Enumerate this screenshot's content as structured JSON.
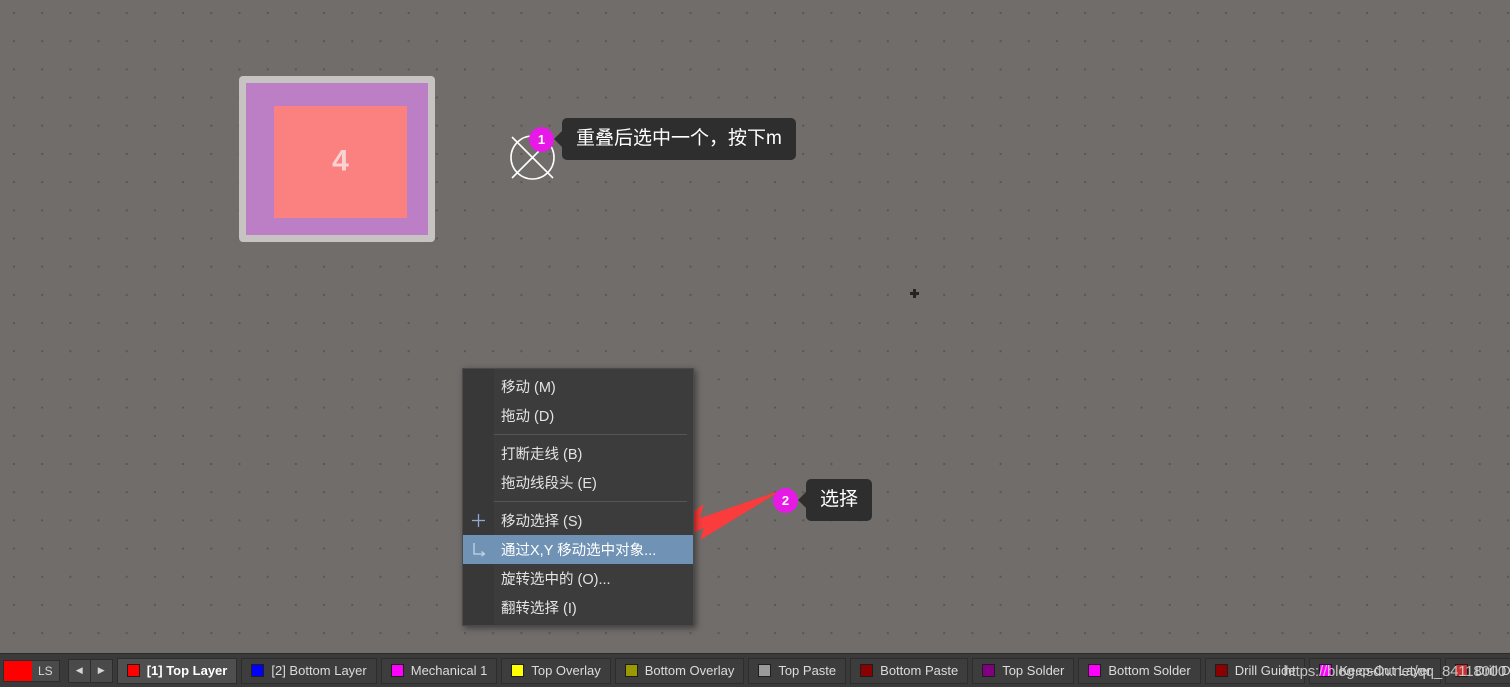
{
  "canvas": {
    "pad": {
      "label": "4",
      "outer_color": "#c6c3c2",
      "mid_color": "#bc7fc5",
      "inner_color": "#fb8080"
    },
    "cursor_icon": "circle-x-cursor-icon"
  },
  "callouts": [
    {
      "number": "1",
      "text": "重叠后选中一个，按下m"
    },
    {
      "number": "2",
      "text": "选择"
    }
  ],
  "context_menu": {
    "items": [
      {
        "label": "移动 (M)",
        "icon": "",
        "selected": false
      },
      {
        "label": "拖动 (D)",
        "icon": "",
        "selected": false
      },
      {
        "label": "打断走线 (B)",
        "icon": "",
        "selected": false
      },
      {
        "label": "拖动线段头 (E)",
        "icon": "",
        "selected": false
      },
      {
        "label": "移动选择 (S)",
        "icon": "crosshair-icon",
        "selected": false
      },
      {
        "label": "通过X,Y 移动选中对象...",
        "icon": "move-xy-icon",
        "selected": true
      },
      {
        "label": "旋转选中的 (O)...",
        "icon": "",
        "selected": false
      },
      {
        "label": "翻转选择 (I)",
        "icon": "",
        "selected": false
      }
    ],
    "separator_after": [
      1,
      3
    ],
    "highlight_color": "#7093b5"
  },
  "layer_bar": {
    "ls_chip": {
      "label": "LS",
      "color": "#ff0000"
    },
    "nav_prev": "◀",
    "nav_next": "▶",
    "tabs": [
      {
        "label": "[1] Top Layer",
        "color": "#ff0000",
        "active": true
      },
      {
        "label": "[2] Bottom Layer",
        "color": "#0000ff",
        "active": false
      },
      {
        "label": "Mechanical 1",
        "color": "#ff00ff",
        "active": false
      },
      {
        "label": "Top Overlay",
        "color": "#ffff00",
        "active": false
      },
      {
        "label": "Bottom Overlay",
        "color": "#9a9a00",
        "active": false
      },
      {
        "label": "Top Paste",
        "color": "#9a9a9a",
        "active": false
      },
      {
        "label": "Bottom Paste",
        "color": "#8b0000",
        "active": false
      },
      {
        "label": "Top Solder",
        "color": "#800080",
        "active": false
      },
      {
        "label": "Bottom Solder",
        "color": "#ff00ff",
        "active": false
      },
      {
        "label": "Drill Guide",
        "color": "#8b0000",
        "active": false
      },
      {
        "label": "Keep-Out Layer",
        "color": "#ff00ff",
        "active": false
      },
      {
        "label": "Drill Drawing",
        "color": "#c83232",
        "active": false
      }
    ]
  },
  "watermark": {
    "text": "https://blog.csdn.net/qq_84118000"
  }
}
